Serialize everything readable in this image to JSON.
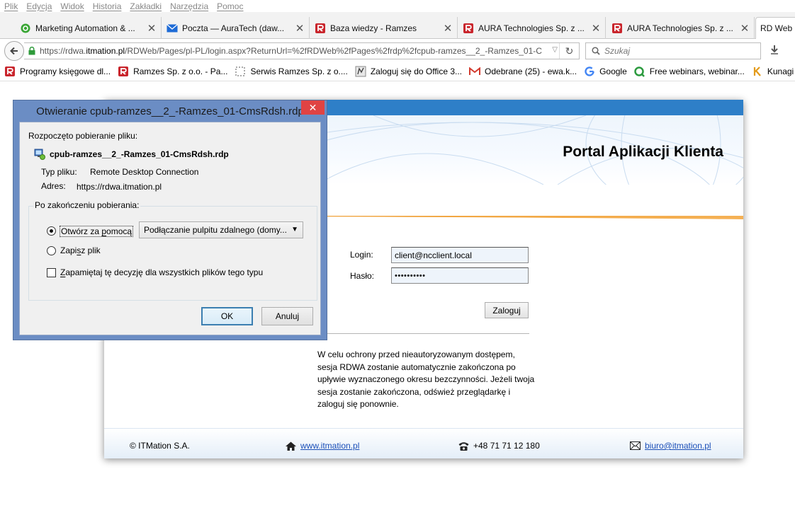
{
  "menu": [
    "Plik",
    "Edycja",
    "Widok",
    "Historia",
    "Zakładki",
    "Narzędzia",
    "Pomoc"
  ],
  "tabs": [
    {
      "label": "Marketing Automation & ...",
      "icon": "green-circle-icon"
    },
    {
      "label": "Poczta — AuraTech (daw...",
      "icon": "mail-icon"
    },
    {
      "label": "Baza wiedzy - Ramzes",
      "icon": "ramzes-icon"
    },
    {
      "label": "AURA Technologies Sp. z ...",
      "icon": "ramzes-icon"
    },
    {
      "label": "AURA Technologies Sp. z ...",
      "icon": "ramzes-icon"
    },
    {
      "label": "RD Web A",
      "icon": ""
    }
  ],
  "address": {
    "prefix": "https://rdwa.",
    "domain": "itmation.pl",
    "path": "/RDWeb/Pages/pl-PL/login.aspx?ReturnUrl=%2fRDWeb%2fPages%2frdp%2fcpub-ramzes__2_-Ramzes_01-C"
  },
  "search": {
    "placeholder": "Szukaj"
  },
  "bookmarks": [
    {
      "label": "Programy księgowe dl...",
      "icon": "ramzes-icon"
    },
    {
      "label": "Ramzes Sp. z o.o. - Pa...",
      "icon": "ramzes-icon"
    },
    {
      "label": "Serwis Ramzes Sp. z o....",
      "icon": "dotted-square-icon"
    },
    {
      "label": "Zaloguj się do Office 3...",
      "icon": "office-icon"
    },
    {
      "label": "Odebrane (25) - ewa.k...",
      "icon": "gmail-icon"
    },
    {
      "label": "Google",
      "icon": "google-icon"
    },
    {
      "label": "Free webinars, webinar...",
      "icon": "webinar-icon"
    },
    {
      "label": "Kunagi @ Ramzes",
      "icon": "kunagi-icon"
    }
  ],
  "portal": {
    "title": "Portal Aplikacji Klienta",
    "login_label": "Login:",
    "login_value": "client@ncclient.local",
    "password_label": "Hasło:",
    "password_value": "••••••••••",
    "login_button": "Zaloguj",
    "notice": "W celu ochrony przed nieautoryzowanym dostępem, sesja RDWA zostanie automatycznie zakończona po upływie wyznaczonego okresu bezczynności. Jeżeli twoja sesja zostanie zakończona, odśwież przeglądarkę i zaloguj się ponownie.",
    "footer": {
      "copyright": "© ITMation S.A.",
      "website": "www.itmation.pl",
      "phone": "+48 71 71 12 180",
      "email": "biuro@itmation.pl"
    }
  },
  "dialog": {
    "title": "Otwieranie cpub-ramzes__2_-Ramzes_01-CmsRdsh.rdp",
    "started": "Rozpoczęto pobieranie pliku:",
    "filename": "cpub-ramzes__2_-Ramzes_01-CmsRdsh.rdp",
    "type_label": "Typ pliku:",
    "type_value": "Remote Desktop Connection",
    "address_label": "Adres:",
    "address_value": "https://rdwa.itmation.pl",
    "group_label": "Po zakończeniu pobierania:",
    "open_with_pre": "Otwórz za ",
    "open_with_u": "p",
    "open_with_post": "omocą",
    "open_with_app": "Podłączanie pulpitu zdalnego (domy...",
    "save_pre": "Zapi",
    "save_u": "s",
    "save_post": "z plik",
    "remember_u": "Z",
    "remember_post": "apamiętaj tę decyzję dla wszystkich plików tego typu",
    "ok": "OK",
    "cancel": "Anuluj"
  }
}
